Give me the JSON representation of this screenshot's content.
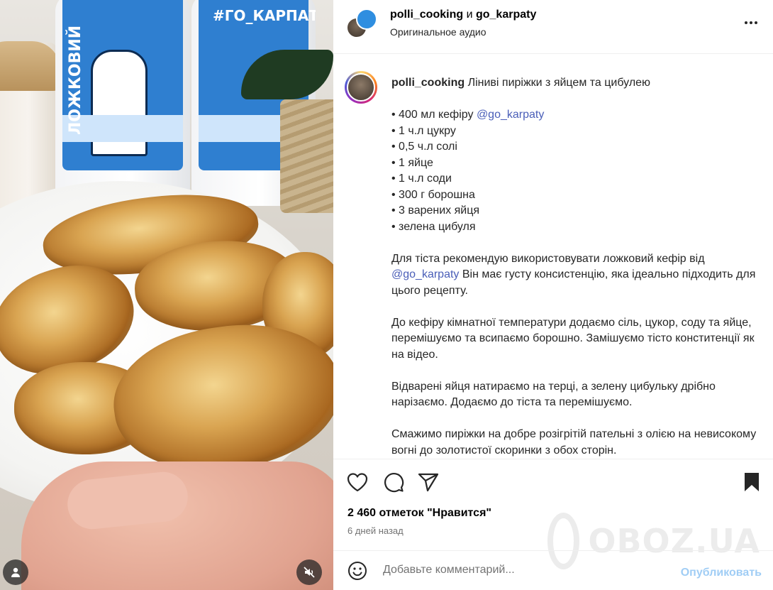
{
  "header": {
    "user1": "polli_cooking",
    "and": "и",
    "user2": "go_karpaty",
    "subtitle": "Оригинальное аудио"
  },
  "media": {
    "bottle1_text": "ЛОЖКОВИЙ",
    "bottle2_text": "#ГО_КАРПАТИ"
  },
  "caption": {
    "username": "polli_cooking",
    "title": "Ліниві пиріжки з яйцем та цибулею",
    "ingredients": [
      "• 400 мл кефіру ",
      "• 1 ч.л цукру",
      "• 0,5 ч.л солі",
      "• 1 яйце",
      "• 1 ч.л соди",
      "• 300 г борошна",
      "• 3 варених яйця",
      "• зелена цибуля"
    ],
    "mention": "@go_karpaty",
    "para1_start": "Для тіста рекомендую використовувати ложковий кефір від ",
    "para1_end": " Він має густу консистенцію, яка ідеально підходить для цього рецепту.",
    "para2": "До кефіру кімнатної температури додаємо сіль, цукор, соду та яйце, перемішуємо та всипаємо борошно. Замішуємо тісто конститенції як на відео.",
    "para3": "Відварені яйця натираємо на терці, а зелену цибульку дрібно нарізаємо. Додаємо до тіста та перемішуємо.",
    "para4": "Смажимо пиріжки на добре розігрітій пательні з олією на невисокому вогні до золотистої скоринки з обох сторін."
  },
  "stats": {
    "likes": "2 460 отметок \"Нравится\"",
    "date": "6 дней назад"
  },
  "comment": {
    "placeholder": "Добавьте комментарий...",
    "post_label": "Опубликовать"
  },
  "watermark": {
    "text": "OBOZ.UA"
  },
  "colors": {
    "mention": "#4a5eb8",
    "post_disabled": "#a0cdf5",
    "text": "#262626"
  }
}
